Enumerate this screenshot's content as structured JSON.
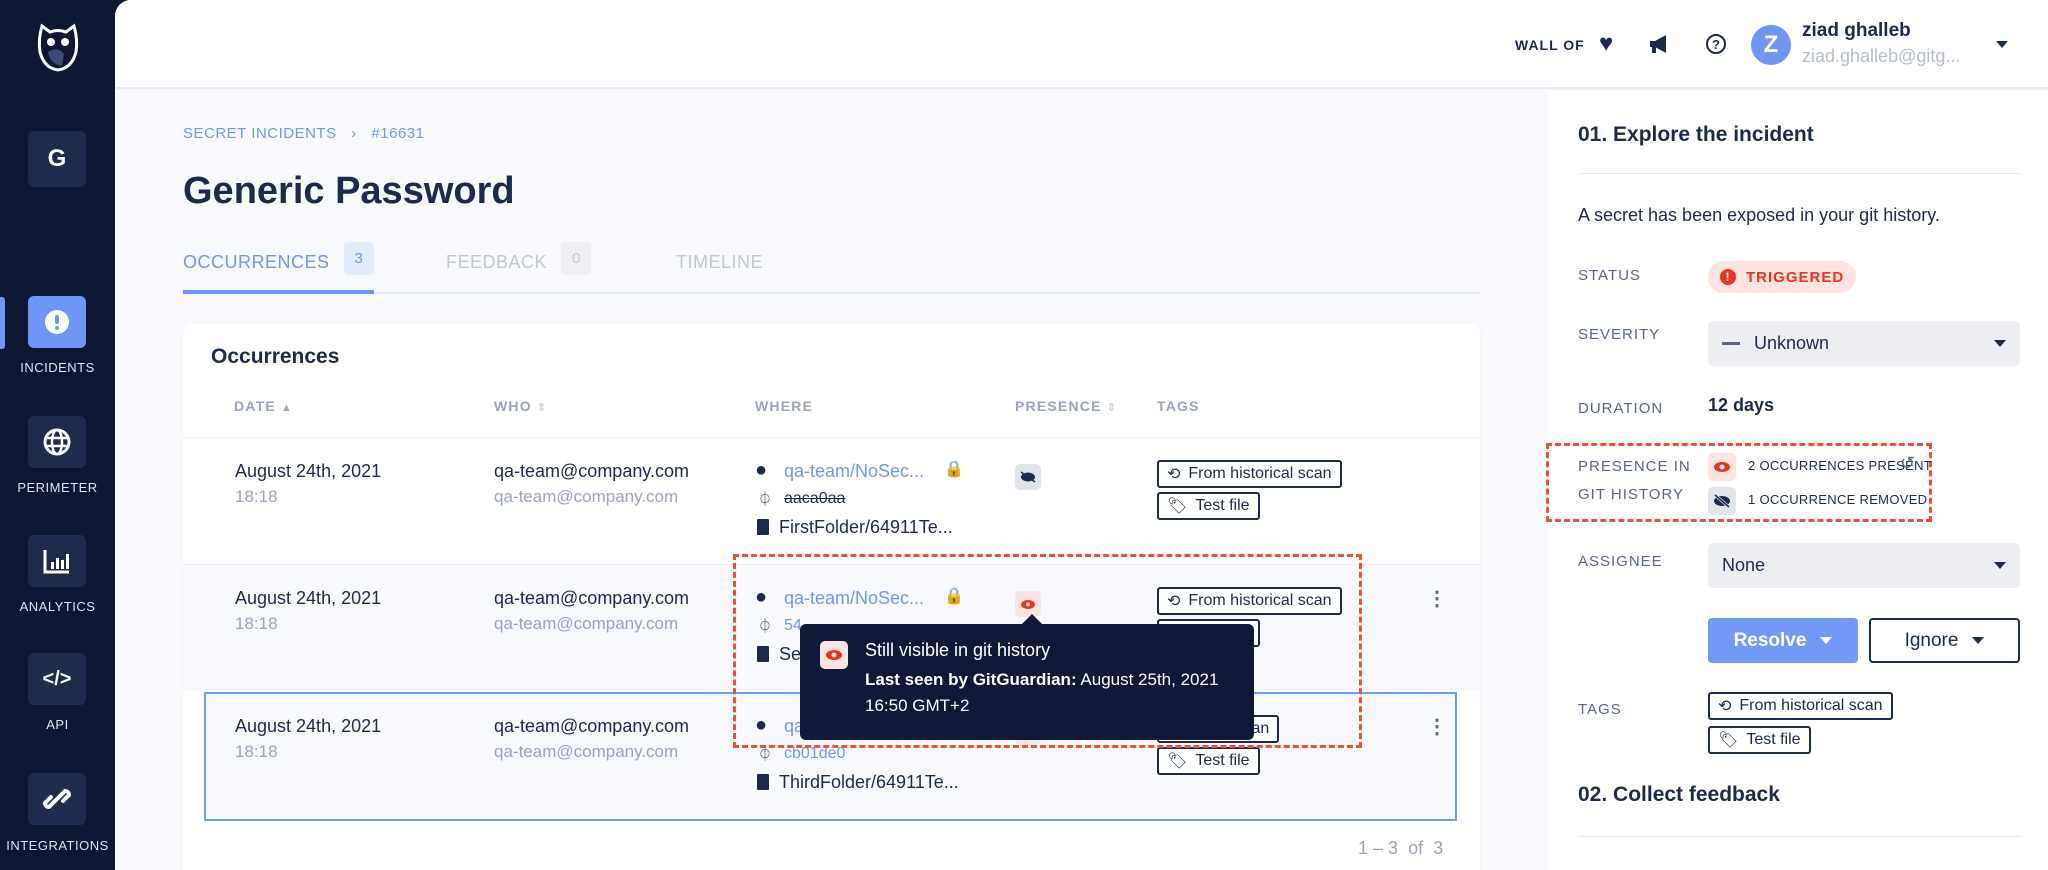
{
  "sidebar": {
    "org_initial": "G",
    "items": [
      {
        "label": "INCIDENTS",
        "icon": "exclamation-icon",
        "active": true
      },
      {
        "label": "PERIMETER",
        "icon": "globe-icon"
      },
      {
        "label": "ANALYTICS",
        "icon": "bar-chart-icon"
      },
      {
        "label": "API",
        "icon": "code-icon"
      },
      {
        "label": "INTEGRATIONS",
        "icon": "link-icon"
      }
    ]
  },
  "header": {
    "wall_of": "WALL OF",
    "user": {
      "initial": "Z",
      "name": "ziad ghalleb",
      "email": "ziad.ghalleb@gitg..."
    }
  },
  "breadcrumb": {
    "root": "SECRET INCIDENTS",
    "sep": "›",
    "current": "#16631"
  },
  "page_title": "Generic Password",
  "tabs": [
    {
      "label": "OCCURRENCES",
      "count": "3",
      "active": true
    },
    {
      "label": "FEEDBACK",
      "count": "0"
    },
    {
      "label": "TIMELINE"
    }
  ],
  "occurrences": {
    "title": "Occurrences",
    "columns": [
      "DATE",
      "WHO",
      "WHERE",
      "PRESENCE",
      "TAGS"
    ],
    "rows": [
      {
        "date": "August 24th, 2021",
        "time": "18:18",
        "who": "qa-team@company.com",
        "who2": "qa-team@company.com",
        "repo": "qa-team/NoSec...",
        "commit": "aaca0aa",
        "file": "FirstFolder/64911Te...",
        "presence": "removed",
        "tags": [
          "From historical scan",
          "Test file"
        ]
      },
      {
        "date": "August 24th, 2021",
        "time": "18:18",
        "who": "qa-team@company.com",
        "who2": "qa-team@company.com",
        "repo": "qa-team/NoSec...",
        "commit": "54",
        "file": "Se",
        "presence": "present",
        "tags": [
          "From historical scan",
          "Test file"
        ]
      },
      {
        "date": "August 24th, 2021",
        "time": "18:18",
        "who": "qa-team@company.com",
        "who2": "qa-team@company.com",
        "repo": "qa",
        "commit": "cb01de0",
        "file": "ThirdFolder/64911Te...",
        "presence": "present",
        "tags": [
          "torical scan",
          "Test file"
        ]
      }
    ],
    "pagination": {
      "range": "1 – 3",
      "of": "of",
      "total": "3"
    }
  },
  "tooltip": {
    "title": "Still visible in git history",
    "label": "Last seen by GitGuardian:",
    "value": " August 25th, 2021 16:50 GMT+2"
  },
  "panel": {
    "title": "01. Explore the incident",
    "description": "A secret has been exposed in your git history.",
    "status_label": "STATUS",
    "status": "TRIGGERED",
    "severity_label": "SEVERITY",
    "severity": "Unknown",
    "duration_label": "DURATION",
    "duration": "12 days",
    "presence_label_1": "PRESENCE IN",
    "presence_label_2": "GIT HISTORY",
    "present": "2 OCCURRENCES PRESENT",
    "removed": "1 OCCURRENCE REMOVED",
    "assignee_label": "ASSIGNEE",
    "assignee": "None",
    "resolve": "Resolve",
    "ignore": "Ignore",
    "tags_label": "TAGS",
    "tags": [
      "From historical scan",
      "Test file"
    ],
    "next_title": "02. Collect feedback"
  },
  "colors": {
    "accent": "#6f95f5",
    "sidebar": "#0d1633",
    "danger": "#e5341f",
    "highlight": "#ef5030"
  }
}
